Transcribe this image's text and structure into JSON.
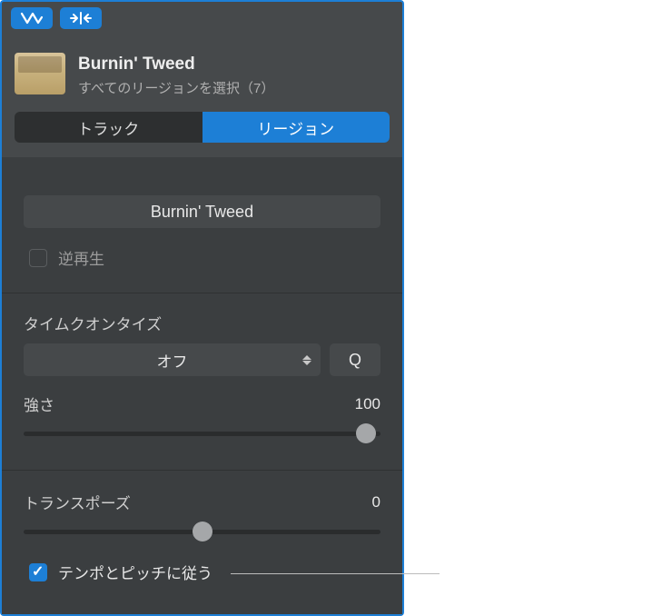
{
  "header": {
    "title": "Burnin' Tweed",
    "subtitle": "すべてのリージョンを選択（7）"
  },
  "tabs": {
    "track": "トラック",
    "region": "リージョン"
  },
  "region_name": "Burnin' Tweed",
  "reverse": {
    "label": "逆再生",
    "checked": false
  },
  "quantize": {
    "title": "タイムクオンタイズ",
    "value": "オフ",
    "button": "Q",
    "strength_label": "強さ",
    "strength_value": "100"
  },
  "transpose": {
    "label": "トランスポーズ",
    "value": "0"
  },
  "follow": {
    "label": "テンポとピッチに従う",
    "checked": true
  }
}
